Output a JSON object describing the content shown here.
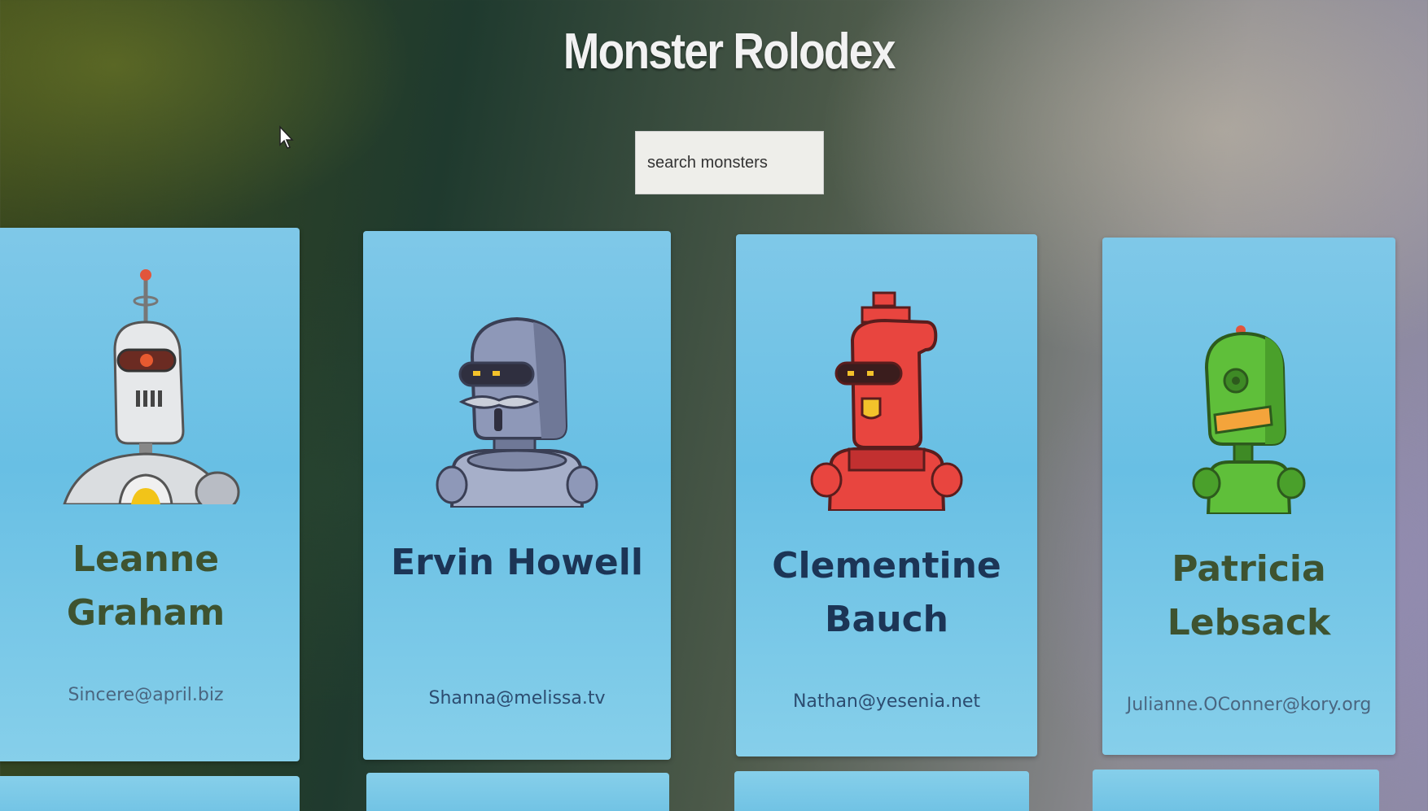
{
  "app": {
    "title": "Monster Rolodex"
  },
  "search": {
    "placeholder": "search monsters",
    "value": ""
  },
  "monsters": [
    {
      "name": "Leanne Graham",
      "email": "Sincere@april.biz",
      "robot_color": "#e6e8ea"
    },
    {
      "name": "Ervin Howell",
      "email": "Shanna@melissa.tv",
      "robot_color": "#8e98b8"
    },
    {
      "name": "Clementine Bauch",
      "email": "Nathan@yesenia.net",
      "robot_color": "#e8453f"
    },
    {
      "name": "Patricia Lebsack",
      "email": "Julianne.OConner@kory.org",
      "robot_color": "#5fbf3a"
    }
  ],
  "colors": {
    "card_background": "#70c3e6",
    "name_text": "#1c3556",
    "title_text": "#f2f2f2"
  }
}
